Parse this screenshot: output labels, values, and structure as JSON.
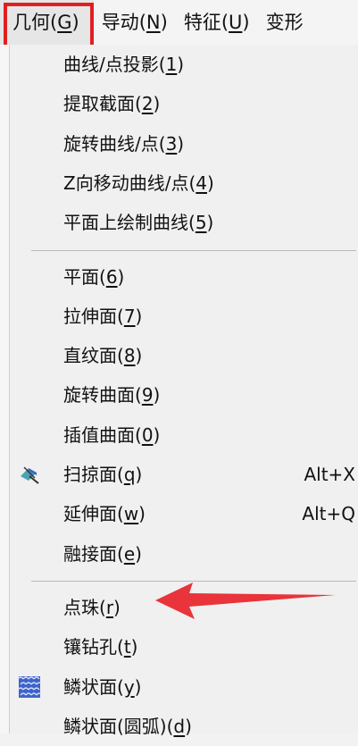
{
  "menubar": [
    {
      "text": "几何",
      "key": "G",
      "name": "menu-geometry",
      "active": true
    },
    {
      "text": "导动",
      "key": "N",
      "name": "menu-sweep"
    },
    {
      "text": "特征",
      "key": "U",
      "name": "menu-feature"
    },
    {
      "text": "变形",
      "key": "",
      "name": "menu-deform",
      "cut": true
    }
  ],
  "groups": [
    {
      "items": [
        {
          "text": "曲线/点投影",
          "key": "1",
          "name": "item-curve-point-projection"
        },
        {
          "text": "提取截面",
          "key": "2",
          "name": "item-extract-section"
        },
        {
          "text": "旋转曲线/点",
          "key": "3",
          "name": "item-rotate-curve-point"
        },
        {
          "text": "Z向移动曲线/点",
          "key": "4",
          "name": "item-z-move-curve-point"
        },
        {
          "text": "平面上绘制曲线",
          "key": "5",
          "name": "item-draw-curve-on-plane"
        }
      ]
    },
    {
      "items": [
        {
          "text": "平面",
          "key": "6",
          "name": "item-plane"
        },
        {
          "text": "拉伸面",
          "key": "7",
          "name": "item-extrude-surface"
        },
        {
          "text": "直纹面",
          "key": "8",
          "name": "item-ruled-surface"
        },
        {
          "text": "旋转曲面",
          "key": "9",
          "name": "item-revolve-surface"
        },
        {
          "text": "插值曲面",
          "key": "0",
          "name": "item-interpolate-surface"
        },
        {
          "text": "扫掠面",
          "key": "q",
          "name": "item-sweep-surface",
          "shortcut": "Alt+X",
          "icon": "sweep-surface-icon"
        },
        {
          "text": "延伸面",
          "key": "w",
          "name": "item-extend-surface",
          "shortcut": "Alt+Q"
        },
        {
          "text": "融接面",
          "key": "e",
          "name": "item-blend-surface"
        }
      ]
    },
    {
      "items": [
        {
          "text": "点珠",
          "key": "r",
          "name": "item-point-bead"
        },
        {
          "text": "镶钻孔",
          "key": "t",
          "name": "item-inlay-drill-hole"
        },
        {
          "text": "鳞状面",
          "key": "y",
          "name": "item-scale-surface",
          "icon": "scale-surface-icon"
        },
        {
          "text": "鳞状面(圆弧)",
          "key": "d",
          "name": "item-scale-surface-arc"
        }
      ]
    }
  ],
  "colors": {
    "highlight_box": "#e02020",
    "arrow": "#e8343a",
    "icon_blue": "#3f63c9",
    "icon_teal": "#4aa3b0"
  }
}
